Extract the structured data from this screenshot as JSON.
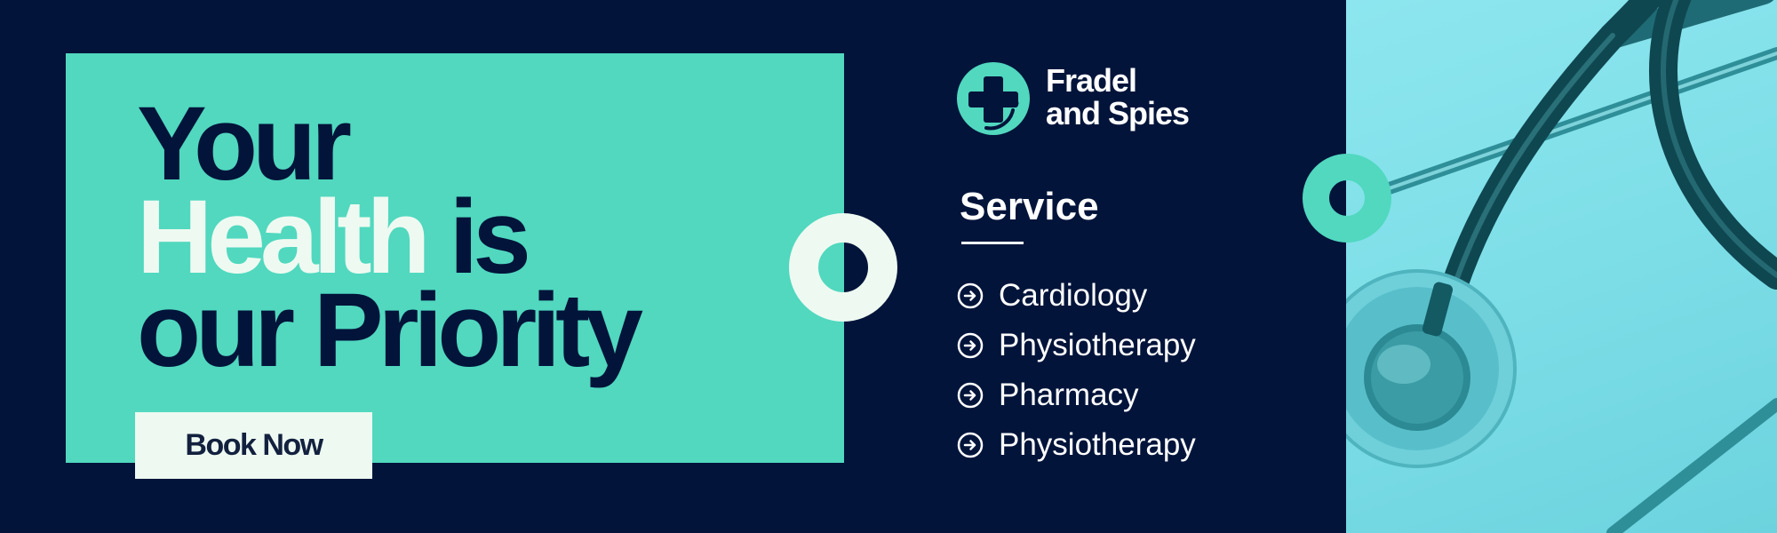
{
  "hero": {
    "headline_line1": "Your",
    "headline_line2_highlight": "Health",
    "headline_line2_rest": "is",
    "headline_line3": "our Priority",
    "book_button_label": "Book Now"
  },
  "brand": {
    "name_line1": "Fradel",
    "name_line2": "and Spies",
    "logo_icon": "medical-cross-icon"
  },
  "services": {
    "heading": "Service",
    "bullet_icon": "arrow-circle-right-icon",
    "items": [
      {
        "label": "Cardiology"
      },
      {
        "label": "Physiotherapy"
      },
      {
        "label": "Pharmacy"
      },
      {
        "label": "Physiotherapy"
      }
    ]
  },
  "photo": {
    "subject": "stethoscope-image"
  },
  "colors": {
    "navy": "#02143a",
    "teal": "#51d8bf",
    "cream": "#eefaf1",
    "photo_tint": "#7fdfe8"
  }
}
